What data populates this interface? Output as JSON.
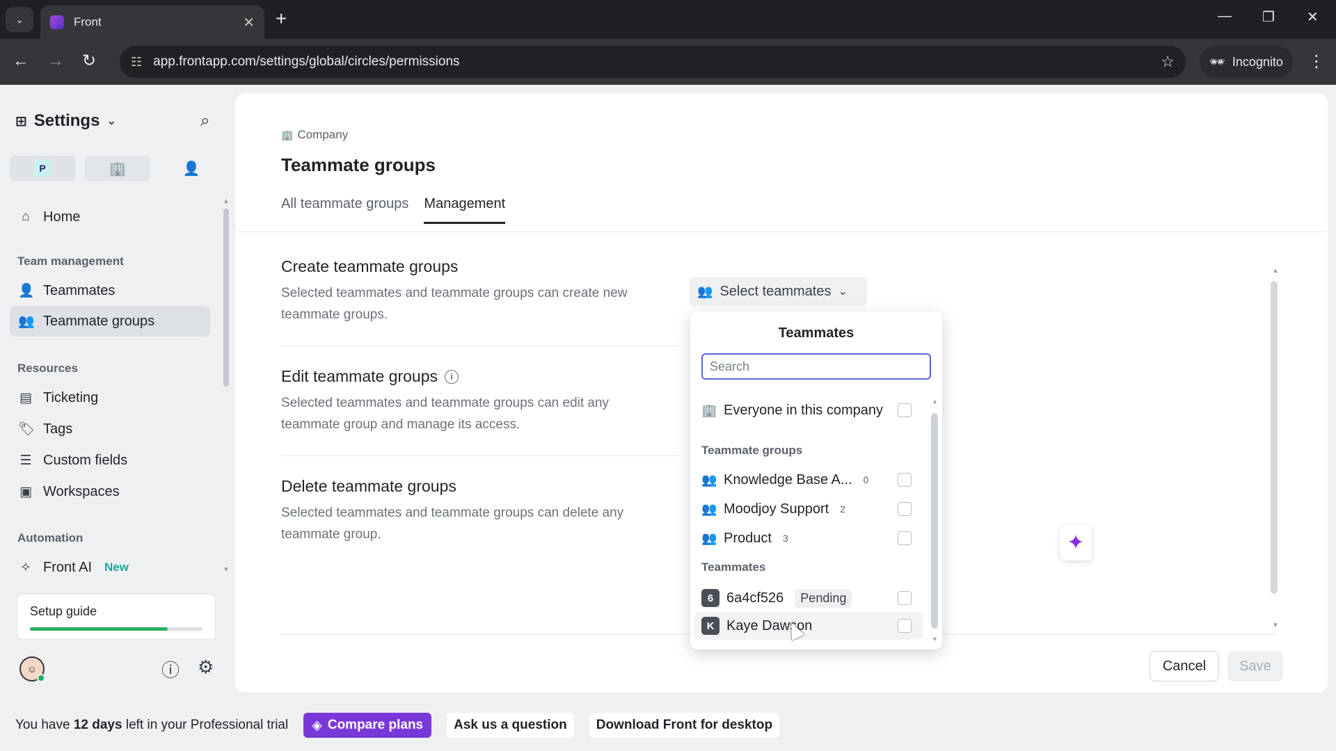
{
  "browser": {
    "tab_title": "Front",
    "url": "app.frontapp.com/settings/global/circles/permissions",
    "incognito_label": "Incognito"
  },
  "sidebar": {
    "title": "Settings",
    "toggle_p": "P",
    "home": "Home",
    "section_team": "Team management",
    "teammates": "Teammates",
    "teammate_groups": "Teammate groups",
    "section_resources": "Resources",
    "ticketing": "Ticketing",
    "tags": "Tags",
    "custom_fields": "Custom fields",
    "workspaces": "Workspaces",
    "section_automation": "Automation",
    "front_ai": "Front AI",
    "new_badge": "New",
    "setup_guide": "Setup guide",
    "setup_progress": 0.8
  },
  "main": {
    "breadcrumb": "Company",
    "title": "Teammate groups",
    "tabs": [
      {
        "label": "All teammate groups"
      },
      {
        "label": "Management"
      }
    ],
    "create": {
      "title": "Create teammate groups",
      "desc": "Selected teammates and teammate groups can create new teammate groups."
    },
    "edit": {
      "title": "Edit teammate groups",
      "desc": "Selected teammates and teammate groups can edit any teammate group and manage its access."
    },
    "delete": {
      "title": "Delete teammate groups",
      "desc": "Selected teammates and teammate groups can delete any teammate group."
    },
    "select_teammates": "Select teammates",
    "cancel": "Cancel",
    "save": "Save"
  },
  "dropdown": {
    "title": "Teammates",
    "search_placeholder": "Search",
    "everyone": "Everyone in this company",
    "section_groups": "Teammate groups",
    "groups": [
      {
        "name": "Knowledge Base A...",
        "count": "0"
      },
      {
        "name": "Moodjoy Support",
        "count": "2"
      },
      {
        "name": "Product",
        "count": "3"
      }
    ],
    "section_teammates": "Teammates",
    "teammates": [
      {
        "initial": "6",
        "name": "6a4cf526",
        "status": "Pending"
      },
      {
        "initial": "K",
        "name": "Kaye Dawson"
      }
    ]
  },
  "trial": {
    "prefix": "You have",
    "days": "12 days",
    "suffix": "left in your Professional trial",
    "compare": "Compare plans",
    "ask": "Ask us a question",
    "download": "Download Front for desktop"
  }
}
